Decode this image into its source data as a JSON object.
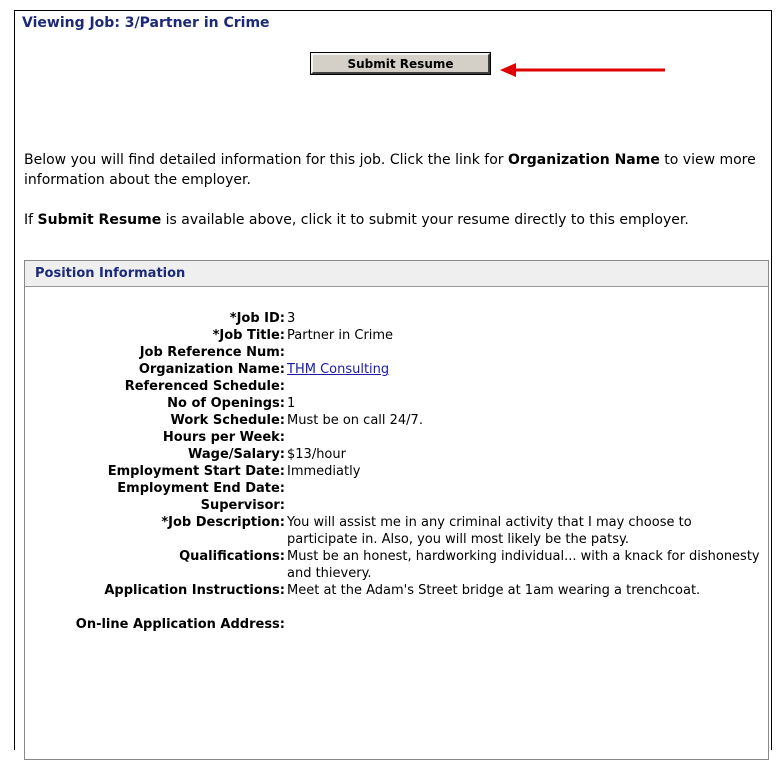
{
  "header": {
    "title": "Viewing Job: 3/Partner in Crime"
  },
  "actions": {
    "submit_label": "Submit Resume"
  },
  "intro": {
    "p1_a": "Below you will find detailed information for this job. Click the link for ",
    "p1_b": "Organization Name",
    "p1_c": " to view more information about the employer.",
    "p2_a": "If ",
    "p2_b": "Submit Resume",
    "p2_c": " is available above, click it to submit your resume directly to this employer."
  },
  "position": {
    "heading": "Position Information",
    "fields": [
      {
        "label": "*Job ID:",
        "value": "3"
      },
      {
        "label": "*Job Title:",
        "value": "Partner in Crime"
      },
      {
        "label": "Job Reference Num:",
        "value": ""
      },
      {
        "label": "Organization Name:",
        "value": "THM Consulting"
      },
      {
        "label": "Referenced Schedule:",
        "value": ""
      },
      {
        "label": "No of Openings:",
        "value": "1"
      },
      {
        "label": "Work Schedule:",
        "value": "Must be on call 24/7."
      },
      {
        "label": "Hours per Week:",
        "value": ""
      },
      {
        "label": "Wage/Salary:",
        "value": "$13/hour"
      },
      {
        "label": "Employment Start Date:",
        "value": "Immediatly"
      },
      {
        "label": "Employment End Date:",
        "value": ""
      },
      {
        "label": "Supervisor:",
        "value": ""
      },
      {
        "label": "*Job Description:",
        "value": "You will assist me in any criminal activity that I may choose to participate in. Also, you will most likely be the patsy."
      },
      {
        "label": "Qualifications:",
        "value": "Must be an honest, hardworking individual... with a knack for dishonesty and thievery."
      },
      {
        "label": "Application Instructions:",
        "value": "Meet at the Adam's Street bridge at 1am wearing a trenchcoat."
      },
      {
        "label": "On-line Application Address:",
        "value": ""
      }
    ]
  },
  "colors": {
    "title": "#1c2a78",
    "link": "#1a1aa8",
    "arrow": "#e00000",
    "header_bg": "#efefef",
    "button_bg": "#d4d0c8"
  }
}
